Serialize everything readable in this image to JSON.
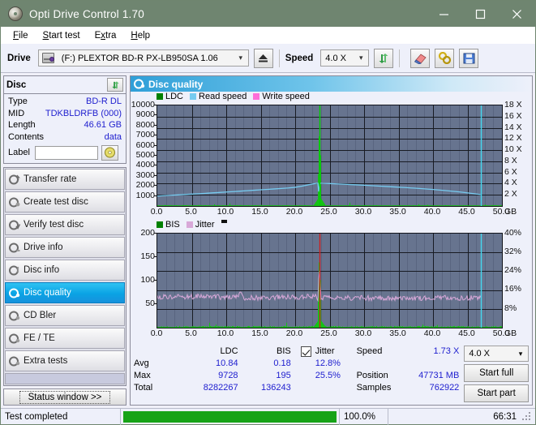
{
  "window": {
    "title": "Opti Drive Control 1.70",
    "icon": "disc-icon",
    "minimize": "minimize-icon",
    "maximize": "maximize-icon",
    "close": "close-icon",
    "titlebar_color": "#6f8570"
  },
  "menu": [
    {
      "label": "File",
      "accel": "F"
    },
    {
      "label": "Start test",
      "accel": "S"
    },
    {
      "label": "Extra",
      "accel": "x"
    },
    {
      "label": "Help",
      "accel": "H"
    }
  ],
  "toolbar": {
    "drive_label": "Drive",
    "drive_value": "(F:)  PLEXTOR BD-R  PX-LB950SA 1.06",
    "eject_icon": "eject-icon",
    "speed_label": "Speed",
    "speed_value": "4.0 X",
    "refresh_icon": "refresh-icon",
    "eraser_icon": "eraser-icon",
    "bitsetting_icon": "bitsetting-icon",
    "save_icon": "save-icon"
  },
  "disc": {
    "title": "Disc",
    "refresh_icon": "refresh-icon",
    "rows": [
      {
        "key": "Type",
        "value": "BD-R DL"
      },
      {
        "key": "MID",
        "value": "TDKBLDRFB (000)"
      },
      {
        "key": "Length",
        "value": "46.61 GB"
      },
      {
        "key": "Contents",
        "value": "data"
      }
    ],
    "label_key": "Label",
    "label_value": "",
    "label_placeholder": "",
    "disc_icon": "cd-icon"
  },
  "nav": {
    "items": [
      {
        "label": "Transfer rate",
        "icon": "disc-test-icon",
        "selected": false
      },
      {
        "label": "Create test disc",
        "icon": "disc-burn-icon",
        "selected": false
      },
      {
        "label": "Verify test disc",
        "icon": "disc-verify-icon",
        "selected": false
      },
      {
        "label": "Drive info",
        "icon": "drive-info-icon",
        "selected": false
      },
      {
        "label": "Disc info",
        "icon": "disc-info-icon",
        "selected": false
      },
      {
        "label": "Disc quality",
        "icon": "disc-quality-icon",
        "selected": true
      },
      {
        "label": "CD Bler",
        "icon": "cd-bler-icon",
        "selected": false
      },
      {
        "label": "FE / TE",
        "icon": "fe-te-icon",
        "selected": false
      },
      {
        "label": "Extra tests",
        "icon": "extra-tests-icon",
        "selected": false
      }
    ],
    "status_window": "Status window >>"
  },
  "panel": {
    "title": "Disc quality",
    "icon": "disc-quality-icon"
  },
  "chart_data": [
    {
      "type": "line",
      "name": "top-chart",
      "title": "",
      "legend": [
        {
          "label": "LDC",
          "color": "#008000"
        },
        {
          "label": "Read speed",
          "color": "#76cbf0"
        },
        {
          "label": "Write speed",
          "color": "#ff6fd8"
        }
      ],
      "legend_position": "top-left",
      "grid": true,
      "xlabel": "GB",
      "xlim": [
        0,
        50
      ],
      "xticks": [
        0.0,
        5.0,
        10.0,
        15.0,
        20.0,
        25.0,
        30.0,
        35.0,
        40.0,
        45.0,
        50.0
      ],
      "xticklabels": [
        "0.0",
        "5.0",
        "10.0",
        "15.0",
        "20.0",
        "25.0",
        "30.0",
        "35.0",
        "40.0",
        "45.0",
        "50.0"
      ],
      "ylabel_left": "LDC",
      "ylim_left": [
        0,
        10000
      ],
      "yticks_left": [
        1000,
        2000,
        3000,
        4000,
        5000,
        6000,
        7000,
        8000,
        9000,
        10000
      ],
      "yticklabels_left": [
        "1000",
        "2000",
        "3000",
        "4000",
        "5000",
        "6000",
        "7000",
        "8000",
        "9000",
        "10000"
      ],
      "ylabel_right": "Speed",
      "ylim_right": [
        0,
        18
      ],
      "yticks_right": [
        2,
        4,
        6,
        8,
        10,
        12,
        14,
        16,
        18
      ],
      "yticklabels_right": [
        "2 X",
        "4 X",
        "6 X",
        "8 X",
        "10 X",
        "12 X",
        "14 X",
        "16 X",
        "18 X"
      ],
      "series": [
        {
          "name": "Read speed",
          "color": "#76cbf0",
          "axis": "right",
          "x": [
            0.0,
            1.0,
            2.0,
            3.0,
            4.0,
            5.0,
            6.0,
            7.0,
            8.0,
            9.0,
            10.0,
            11.0,
            12.0,
            13.0,
            14.0,
            15.0,
            16.0,
            17.0,
            18.0,
            19.0,
            20.0,
            21.0,
            22.0,
            23.0,
            23.3,
            23.4,
            23.6,
            24.0,
            25.0,
            26.0,
            27.0,
            28.0,
            29.0,
            30.0,
            32.0,
            34.0,
            36.0,
            38.0,
            40.0,
            42.0,
            44.0,
            46.0,
            46.9
          ],
          "y": [
            1.78,
            1.85,
            1.92,
            1.99,
            2.06,
            2.13,
            2.2,
            2.27,
            2.35,
            2.42,
            2.5,
            2.58,
            2.66,
            2.74,
            2.82,
            2.9,
            2.98,
            3.06,
            3.14,
            3.23,
            3.35,
            3.55,
            3.82,
            4.05,
            4.08,
            2.6,
            4.08,
            4.05,
            4.02,
            3.96,
            3.9,
            3.84,
            3.78,
            3.72,
            3.58,
            3.44,
            3.3,
            3.14,
            2.96,
            2.74,
            2.5,
            2.2,
            2.05
          ]
        },
        {
          "name": "LDC",
          "color": "#00b000",
          "axis": "left",
          "note": "dense near-zero noise floor across disc with a large spike at 23.5 GB reaching 9728",
          "baseline": 60,
          "spike_x": 23.5,
          "spike_y": 9728
        }
      ],
      "markers": [
        {
          "type": "vline",
          "x": 23.5,
          "color": "#00d000"
        },
        {
          "type": "vline",
          "x": 46.95,
          "color": "#45d7ef"
        }
      ]
    },
    {
      "type": "line",
      "name": "bottom-chart",
      "title": "",
      "legend": [
        {
          "label": "BIS",
          "color": "#008000"
        },
        {
          "label": "Jitter",
          "color": "#d8a8d8"
        }
      ],
      "legend_position": "top-left",
      "grid": true,
      "xlabel": "GB",
      "xlim": [
        0,
        50
      ],
      "xticks": [
        0.0,
        5.0,
        10.0,
        15.0,
        20.0,
        25.0,
        30.0,
        35.0,
        40.0,
        45.0,
        50.0
      ],
      "xticklabels": [
        "0.0",
        "5.0",
        "10.0",
        "15.0",
        "20.0",
        "25.0",
        "30.0",
        "35.0",
        "40.0",
        "45.0",
        "50.0"
      ],
      "ylabel_left": "BIS",
      "ylim_left": [
        0,
        200
      ],
      "yticks_left": [
        50,
        100,
        150,
        200
      ],
      "yticklabels_left": [
        "50",
        "100",
        "150",
        "200"
      ],
      "ylabel_right": "Jitter",
      "ylim_right": [
        0,
        40
      ],
      "yticks_right": [
        8,
        16,
        24,
        32,
        40
      ],
      "yticklabels_right": [
        "8%",
        "16%",
        "24%",
        "32%",
        "40%"
      ],
      "series": [
        {
          "name": "Jitter",
          "color": "#d8a8d8",
          "axis": "right",
          "note": "noisy band averaging ~12.8% with spike to 25.5% near 23.7 GB",
          "avg": 12.8,
          "max": 25.5
        },
        {
          "name": "BIS",
          "color": "#00b000",
          "axis": "left",
          "note": "low noise floor near zero with spike at 23.5 GB reaching 195",
          "spike_x": 23.5,
          "spike_y": 195
        }
      ],
      "markers": [
        {
          "type": "vline",
          "x": 23.5,
          "color": "#cc2020"
        },
        {
          "type": "vline",
          "x": 46.95,
          "color": "#45d7ef"
        }
      ]
    }
  ],
  "stats": {
    "col_headers": [
      "LDC",
      "BIS"
    ],
    "rows": [
      {
        "label": "Avg",
        "ldc": "10.84",
        "bis": "0.18"
      },
      {
        "label": "Max",
        "ldc": "9728",
        "bis": "195"
      },
      {
        "label": "Total",
        "ldc": "8282267",
        "bis": "136243"
      }
    ],
    "jitter": {
      "checked": true,
      "label": "Jitter",
      "avg": "12.8%",
      "max": "25.5%"
    },
    "speed_label": "Speed",
    "speed_value": "1.73 X",
    "position_label": "Position",
    "position_value": "47731 MB",
    "samples_label": "Samples",
    "samples_value": "762922",
    "speed_select": "4.0 X",
    "start_full": "Start full",
    "start_part": "Start part"
  },
  "statusbar": {
    "message": "Test completed",
    "progress_percent": "100.0%",
    "progress_value": 100,
    "elapsed": "66:31"
  }
}
